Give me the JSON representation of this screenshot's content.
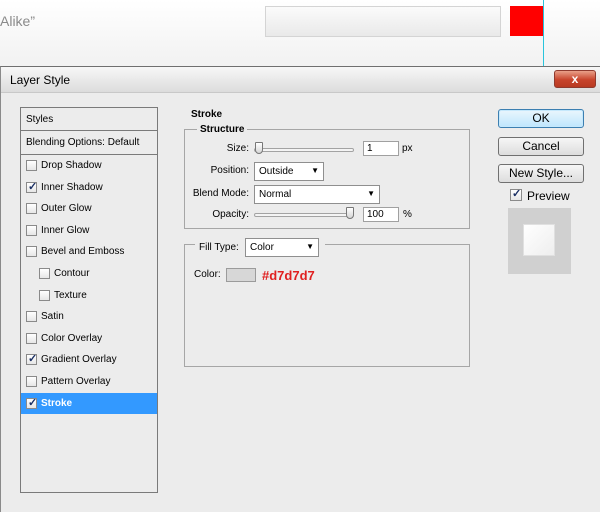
{
  "background": {
    "snippet_text": "Alike”",
    "red_swatch_color": "#ff0000"
  },
  "dialog": {
    "title": "Layer Style",
    "close_label": "x"
  },
  "styles_list": {
    "header": "Styles",
    "blending": "Blending Options: Default",
    "items": [
      {
        "label": "Drop Shadow",
        "checked": false,
        "indent": false,
        "selected": false
      },
      {
        "label": "Inner Shadow",
        "checked": true,
        "indent": false,
        "selected": false
      },
      {
        "label": "Outer Glow",
        "checked": false,
        "indent": false,
        "selected": false
      },
      {
        "label": "Inner Glow",
        "checked": false,
        "indent": false,
        "selected": false
      },
      {
        "label": "Bevel and Emboss",
        "checked": false,
        "indent": false,
        "selected": false
      },
      {
        "label": "Contour",
        "checked": false,
        "indent": true,
        "selected": false
      },
      {
        "label": "Texture",
        "checked": false,
        "indent": true,
        "selected": false
      },
      {
        "label": "Satin",
        "checked": false,
        "indent": false,
        "selected": false
      },
      {
        "label": "Color Overlay",
        "checked": false,
        "indent": false,
        "selected": false
      },
      {
        "label": "Gradient Overlay",
        "checked": true,
        "indent": false,
        "selected": false
      },
      {
        "label": "Pattern Overlay",
        "checked": false,
        "indent": false,
        "selected": false
      },
      {
        "label": "Stroke",
        "checked": true,
        "indent": false,
        "selected": true
      }
    ],
    "check_mark": "✓"
  },
  "stroke": {
    "title": "Stroke",
    "structure_title": "Structure",
    "size_label": "Size:",
    "size_value": "1",
    "size_unit": "px",
    "size_slider_fraction": 0.01,
    "position_label": "Position:",
    "position_value": "Outside",
    "blend_label": "Blend Mode:",
    "blend_value": "Normal",
    "opacity_label": "Opacity:",
    "opacity_value": "100",
    "opacity_unit": "%",
    "opacity_slider_fraction": 1.0,
    "fill_type_label": "Fill Type:",
    "fill_type_value": "Color",
    "color_label": "Color:",
    "color_swatch": "#d7d7d7",
    "color_hex_text": "#d7d7d7"
  },
  "buttons": {
    "ok": "OK",
    "cancel": "Cancel",
    "new_style": "New Style...",
    "preview_label": "Preview",
    "preview_checked": true
  },
  "icons": {
    "dropdown_arrow": "▼"
  }
}
